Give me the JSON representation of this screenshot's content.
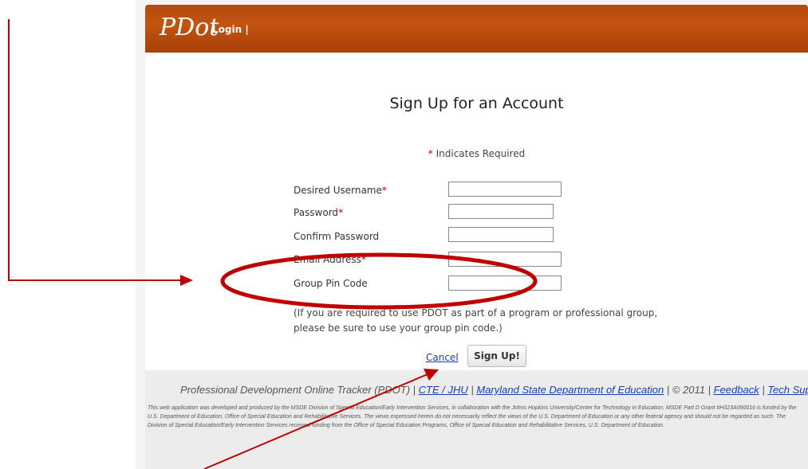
{
  "header": {
    "brand": "PDot",
    "login_link": "Login |"
  },
  "form": {
    "title": "Sign Up for an Account",
    "required_note": {
      "star": "*",
      "text": " Indicates Required"
    },
    "fields": [
      {
        "label": "Desired Username",
        "required": "*",
        "value": ""
      },
      {
        "label": "Password",
        "required": "*",
        "value": ""
      },
      {
        "label": "Confirm Password",
        "required": "",
        "value": ""
      },
      {
        "label": "Email Address",
        "required": "*",
        "value": ""
      },
      {
        "label": "Group Pin Code",
        "required": "",
        "value": ""
      }
    ],
    "pin_note": "(If you are required to use PDOT as part of a program or professional group, please be sure to use your group pin code.)",
    "cancel_label": "Cancel",
    "signup_label": "Sign Up!"
  },
  "footer": {
    "product": "Professional Development Online Tracker (PDOT)",
    "sep": " | ",
    "link_cte": "CTE / JHU",
    "link_msde": "Maryland State Department of Education",
    "copyright": "© 2011",
    "link_feedback": "Feedback",
    "link_support": "Tech Support",
    "disclaimer": "This web application was developed and produced by the MSDE Division of Special Education/Early Intervention Services, in collaboration with the Johns Hopkins University/Center for Technology in Education. MSDE Part D Grant #H323A090016 is funded by the U.S. Department of Education, Office of Special Education and Rehabilitative Services. The views expressed herein do not necessarily reflect the views of the U.S. Department of Education or any other federal agency and should not be regarded as such. The Division of Special Education/Early Intervention Services received funding from the Office of Special Education Programs, Office of Special Education and Rehabilitative Services, U.S. Department of Education."
  },
  "colors": {
    "header_orange": "#c4540f",
    "annotation_red": "#c00000",
    "link_blue": "#1a3db5"
  }
}
